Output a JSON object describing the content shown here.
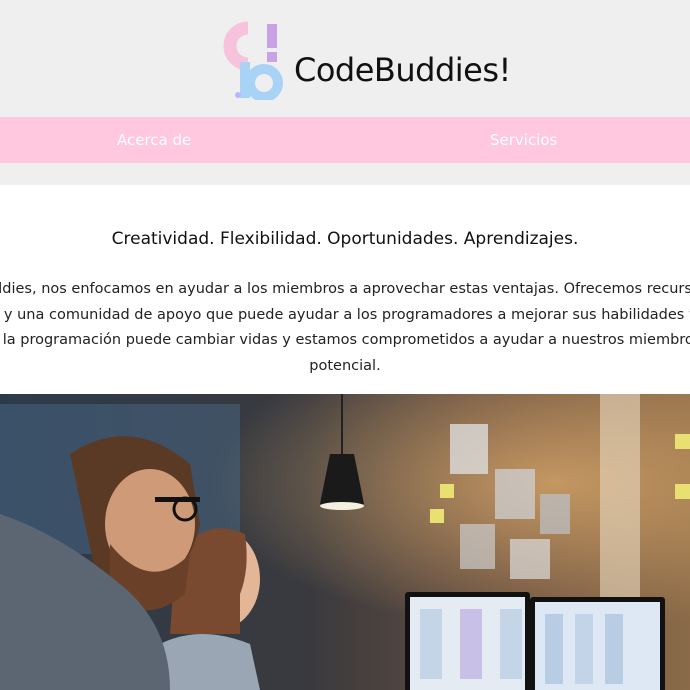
{
  "brand": {
    "name": "CodeBuddies!",
    "logo_letters": "cb!"
  },
  "nav": {
    "items": [
      {
        "label": "Acerca de"
      },
      {
        "label": "Servicios"
      }
    ]
  },
  "content": {
    "headline": "Creatividad. Flexibilidad. Oportunidades. Aprendizajes.",
    "lines": [
      "eBuddies, nos enfocamos en ayudar a los miembros a aprovechar estas ventajas. Ofrecemos recursos de apre",
      "ntas y una comunidad de apoyo que puede ayudar a los programadores a mejorar sus habilidades y alcanzar s",
      "ue la programación puede cambiar vidas y estamos comprometidos a ayudar a nuestros miembros a alcanzar",
      "potencial."
    ]
  },
  "colors": {
    "nav_bg": "#ffc8df",
    "page_bg": "#efefef",
    "logo_pink": "#f7c3dc",
    "logo_purple": "#c9a2e6",
    "logo_blue": "#a9d2f7"
  },
  "hero": {
    "icon": "office-photo"
  }
}
